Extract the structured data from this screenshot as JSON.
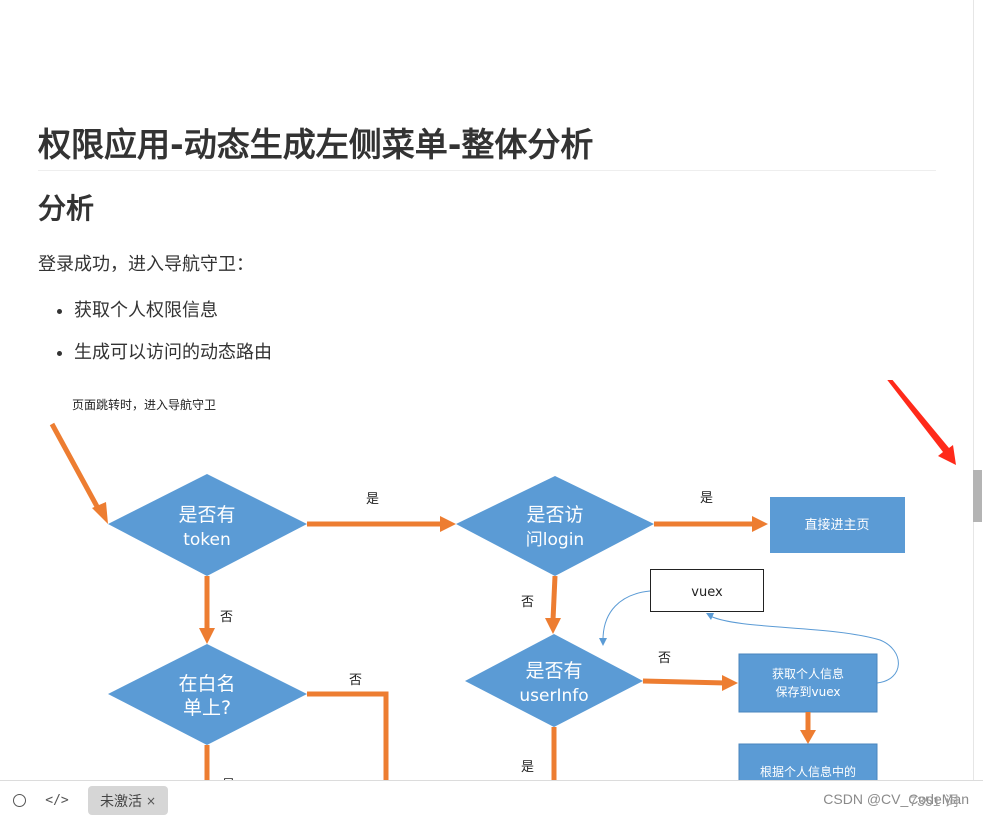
{
  "document": {
    "title": "权限应用-动态生成左侧菜单-整体分析",
    "section_heading": "分析",
    "intro": "登录成功，进入导航守卫：",
    "bullets": [
      "获取个人权限信息",
      "生成可以访问的动态路由"
    ]
  },
  "diagram": {
    "caption": "页面跳转时，进入导航守卫",
    "nodes": {
      "has_token": {
        "line1": "是否有",
        "line2": "token"
      },
      "visit_login": {
        "line1": "是否访",
        "line2": "问login"
      },
      "go_home": {
        "label": "直接进主页"
      },
      "vuex": {
        "label": "vuex"
      },
      "in_whitelist": {
        "line1": "在白名",
        "line2": "单上?"
      },
      "has_userinfo": {
        "line1": "是否有",
        "line2": "userInfo"
      },
      "fetch_info": {
        "line1": "获取个人信息",
        "line2": "保存到vuex"
      },
      "by_info": {
        "line1": "根据个人信息中的"
      }
    },
    "edge_labels": {
      "token_yes": "是",
      "token_no": "否",
      "login_yes": "是",
      "login_no": "否",
      "whitelist_no": "否",
      "whitelist_yes": "是",
      "userinfo_no": "否",
      "userinfo_yes": "是"
    },
    "colors": {
      "shape_fill": "#5b9bd5",
      "arrow": "#ed7d31",
      "connector": "#5b9bd5",
      "annotation_arrow": "#ff2a1a"
    }
  },
  "bottom_bar": {
    "tab_label": "未激活",
    "tab_close": "×",
    "watermark": "CSDN @CV_CodeMan",
    "word_count": "7351 词"
  }
}
